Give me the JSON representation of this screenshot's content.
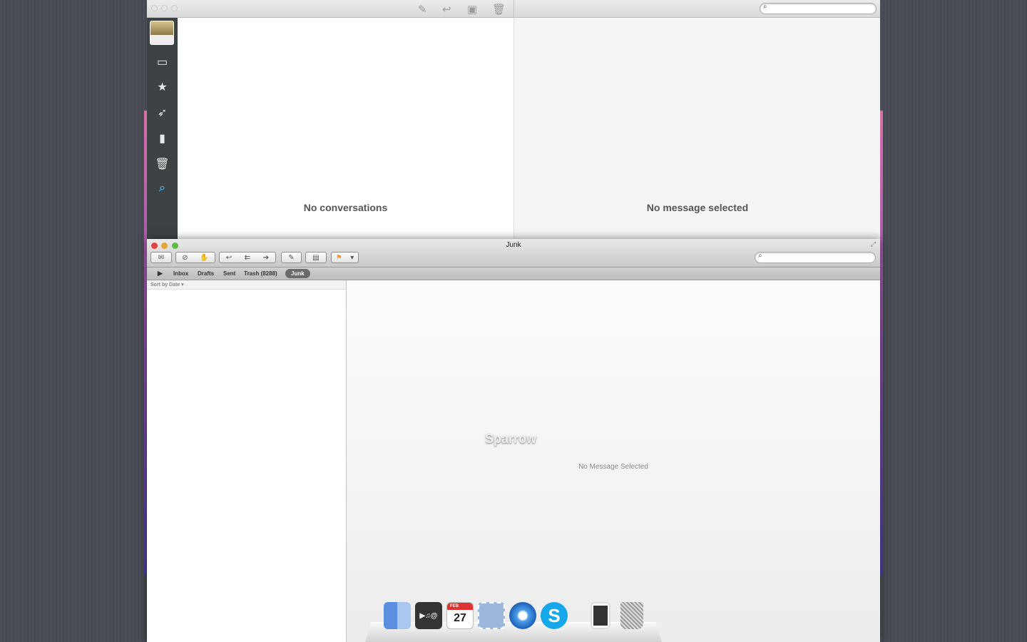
{
  "sparrow": {
    "empty_list": "No conversations",
    "empty_message": "No message selected",
    "toolbar": [
      "compose-icon",
      "reply-icon",
      "archive-icon",
      "trash-icon"
    ],
    "sidebar": [
      "avatar",
      "inbox-icon",
      "star-icon",
      "sent-icon",
      "drafts-icon",
      "trash-icon",
      "search-icon"
    ]
  },
  "mail": {
    "title": "Junk",
    "favorites": {
      "inbox": "Inbox",
      "drafts": "Drafts",
      "sent": "Sent",
      "trash": "Trash (8288)",
      "junk": "Junk"
    },
    "sort_label": "Sort by Date ▾",
    "watermark": "Sparrow",
    "no_message": "No Message Selected"
  },
  "dock": {
    "calendar_month": "FEB",
    "calendar_day": "27"
  }
}
